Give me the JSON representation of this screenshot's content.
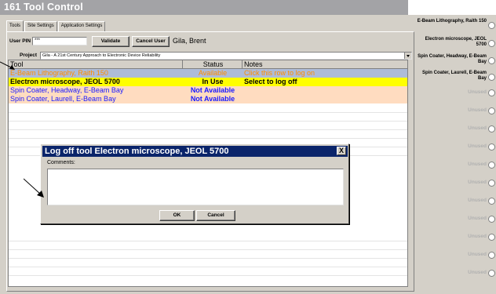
{
  "window": {
    "title": "161 Tool Control"
  },
  "tabs": [
    {
      "label": "Tools"
    },
    {
      "label": "Site Settings"
    },
    {
      "label": "Application Settings"
    }
  ],
  "login": {
    "pin_label": "User PIN",
    "pin_value": "***",
    "validate_label": "Validate",
    "cancel_user_label": "Cancel User",
    "user_name": "Gila, Brent"
  },
  "project": {
    "label": "Project",
    "selected": "Gila - A 21st Century Approach to Electronic Device Reliability"
  },
  "table": {
    "headers": [
      "Tool",
      "Status",
      "Notes"
    ],
    "rows": [
      {
        "tool": "E-Beam Lithography, Raith 150",
        "status": "Available",
        "notes": "Click this row to log on"
      },
      {
        "tool": "Electron microscope, JEOL 5700",
        "status": "In Use",
        "notes": "Select to log off"
      },
      {
        "tool": "Spin Coater, Headway, E-Beam Bay",
        "status": "Not Available",
        "notes": ""
      },
      {
        "tool": "Spin Coater, Laurell, E-Beam Bay",
        "status": "Not Available",
        "notes": ""
      }
    ]
  },
  "dialog": {
    "title": "Log off tool Electron microscope, JEOL 5700",
    "close_label": "X",
    "comments_label": "Comments:",
    "ok_label": "OK",
    "cancel_label": "Cancel"
  },
  "sidebar": {
    "items": [
      {
        "label": "E-Beam Lithography, Raith 150"
      },
      {
        "label": "Electron microscope, JEOL 5700"
      },
      {
        "label": "Spin Coater, Headway, E-Beam Bay"
      },
      {
        "label": "Spin Coater, Laurell, E-Beam Bay"
      },
      {
        "label": "Unused"
      },
      {
        "label": "Unused"
      },
      {
        "label": "Unused"
      },
      {
        "label": "Unused"
      },
      {
        "label": "Unused"
      },
      {
        "label": "Unused"
      },
      {
        "label": "Unused"
      },
      {
        "label": "Unused"
      },
      {
        "label": "Unused"
      },
      {
        "label": "Unused"
      },
      {
        "label": "Unused"
      }
    ]
  },
  "colors": {
    "row_available_bg": "#aebcd8",
    "row_available_text": "#ff8c00",
    "row_inuse_bg": "#ffff00",
    "row_notavailable_bg": "#ffdcc0",
    "row_notavailable_text": "#1a1aff",
    "dialog_titlebar": "#0a246a"
  },
  "icons": [
    "arrow-pointer-icon",
    "close-icon",
    "dropdown-arrow-icon",
    "radio-icon"
  ]
}
